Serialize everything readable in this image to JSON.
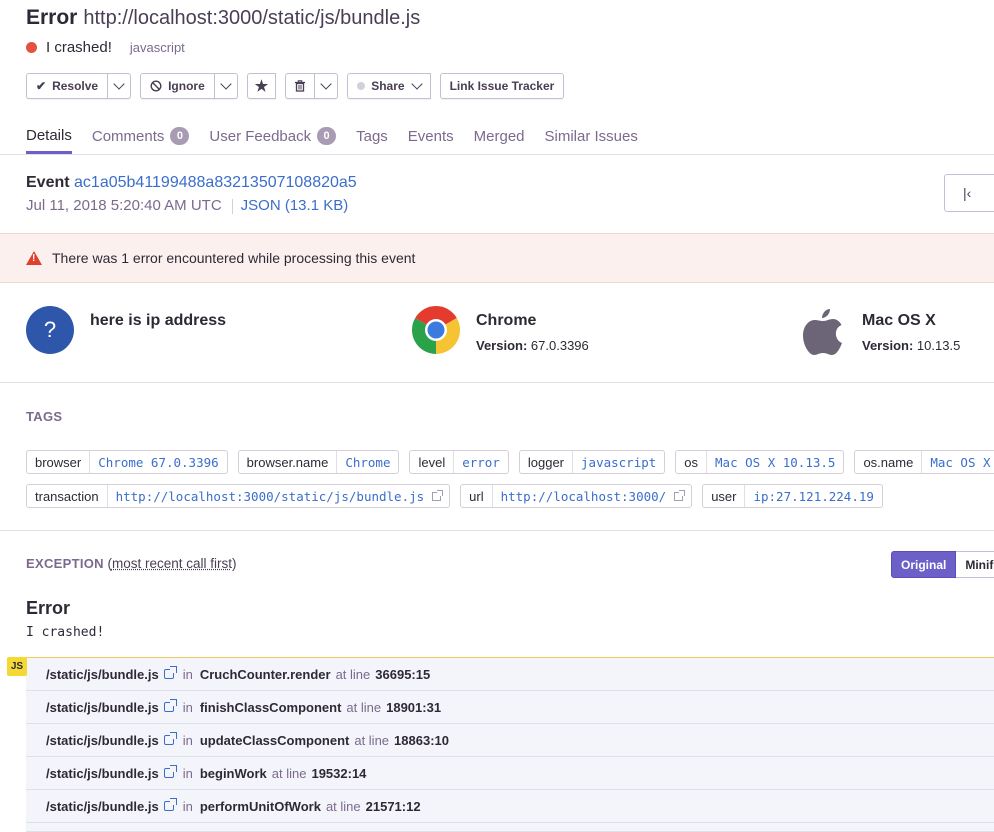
{
  "header": {
    "type": "Error",
    "url": "http://localhost:3000/static/js/bundle.js",
    "message": "I crashed!",
    "platform": "javascript",
    "status_color": "#e35141"
  },
  "toolbar": {
    "resolve": "Resolve",
    "ignore": "Ignore",
    "share": "Share",
    "link_tracker": "Link Issue Tracker",
    "resolve_icon": "check-icon",
    "ignore_icon": "ban-icon",
    "bookmark_icon": "star-icon",
    "delete_icon": "trash-icon"
  },
  "tabs": [
    {
      "label": "Details",
      "active": true
    },
    {
      "label": "Comments",
      "badge": "0"
    },
    {
      "label": "User Feedback",
      "badge": "0"
    },
    {
      "label": "Tags"
    },
    {
      "label": "Events"
    },
    {
      "label": "Merged"
    },
    {
      "label": "Similar Issues"
    }
  ],
  "event": {
    "label": "Event",
    "id": "ac1a05b41199488a83213507108820a5",
    "date": "Jul 11, 2018 5:20:40 AM UTC",
    "json": "JSON (13.1 KB)"
  },
  "alert": {
    "text": "There was 1 error encountered while processing this event",
    "icon": "warning-icon"
  },
  "context": {
    "user": {
      "title": "here is ip address",
      "icon": "question-icon"
    },
    "browser": {
      "title": "Chrome",
      "version_label": "Version:",
      "version": "67.0.3396",
      "icon": "chrome-icon"
    },
    "os": {
      "title": "Mac OS X",
      "version_label": "Version:",
      "version": "10.13.5",
      "icon": "apple-icon"
    }
  },
  "tags": {
    "title": "TAGS",
    "row1": [
      {
        "key": "browser",
        "value": "Chrome 67.0.3396"
      },
      {
        "key": "browser.name",
        "value": "Chrome"
      },
      {
        "key": "level",
        "value": "error"
      },
      {
        "key": "logger",
        "value": "javascript"
      },
      {
        "key": "os",
        "value": "Mac OS X 10.13.5"
      },
      {
        "key": "os.name",
        "value": "Mac OS X"
      }
    ],
    "row2": [
      {
        "key": "transaction",
        "value": "http://localhost:3000/static/js/bundle.js",
        "external": true
      },
      {
        "key": "url",
        "value": "http://localhost:3000/",
        "external": true
      },
      {
        "key": "user",
        "value": "ip:27.121.224.19"
      }
    ]
  },
  "exception": {
    "title": "EXCEPTION",
    "subtitle": "most recent call first",
    "view_original": "Original",
    "view_minified": "Minified",
    "type": "Error",
    "value": "I crashed!",
    "platform_badge": "JS",
    "in_label": "in",
    "at_label": "at line",
    "frames": [
      {
        "file": "/static/js/bundle.js",
        "function": "CruchCounter.render",
        "line": "36695:15"
      },
      {
        "file": "/static/js/bundle.js",
        "function": "finishClassComponent",
        "line": "18901:31"
      },
      {
        "file": "/static/js/bundle.js",
        "function": "updateClassComponent",
        "line": "18863:10"
      },
      {
        "file": "/static/js/bundle.js",
        "function": "beginWork",
        "line": "19532:14"
      },
      {
        "file": "/static/js/bundle.js",
        "function": "performUnitOfWork",
        "line": "21571:12"
      }
    ]
  }
}
